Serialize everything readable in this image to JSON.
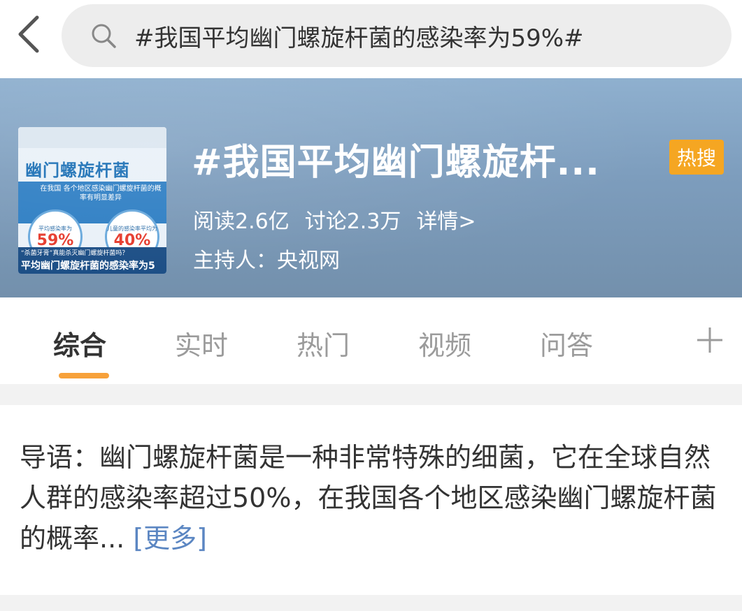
{
  "search": {
    "query": "#我国平均幽门螺旋杆菌的感染率为59%#"
  },
  "banner": {
    "title": "#我国平均幽门螺旋杆...",
    "badge": "热搜",
    "stats": {
      "reads": "阅读2.6亿",
      "discussions": "讨论2.3万",
      "details": "详情>"
    },
    "host": "主持人：央视网",
    "thumbnail": {
      "title": "幽门螺旋杆菌",
      "subtitle": "在我国 各个地区感染幽门螺旋杆菌的概率有明显差异",
      "circle1_label": "平均感染率为",
      "circle1_value": "59%",
      "circle2_label": "儿童的感染率平均为",
      "circle2_value": "40%",
      "caption_small": "“杀菌牙膏”真能杀灭幽门螺旋杆菌吗？",
      "caption_large": "平均幽门螺旋杆菌的感染率为5"
    }
  },
  "tabs": [
    {
      "label": "综合"
    },
    {
      "label": "实时"
    },
    {
      "label": "热门"
    },
    {
      "label": "视频"
    },
    {
      "label": "问答"
    }
  ],
  "intro": {
    "text": "导语：幽门螺旋杆菌是一种非常特殊的细菌，它在全球自然人群的感染率超过50%，在我国各个地区感染幽门螺旋杆菌的概率...",
    "more": "[更多]"
  },
  "colors": {
    "accent_orange": "#f7a13a",
    "badge_orange": "#f5a622",
    "link_blue": "#5b86c2"
  }
}
